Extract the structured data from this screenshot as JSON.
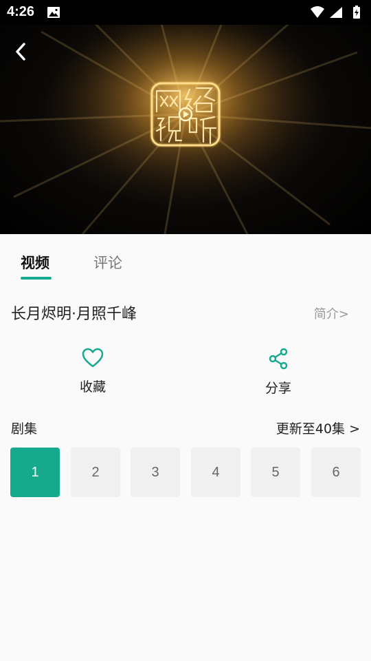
{
  "status_bar": {
    "time": "4:26"
  },
  "video": {
    "logo_text": "网络视听"
  },
  "tabs": [
    {
      "label": "视频",
      "active": true
    },
    {
      "label": "评论",
      "active": false
    }
  ],
  "title": "长月烬明·月照千峰",
  "intro_link": "简介>",
  "actions": {
    "favorite": "收藏",
    "share": "分享"
  },
  "episodes": {
    "header": "剧集",
    "update_text": "更新至40集 >",
    "items": [
      "1",
      "2",
      "3",
      "4",
      "5",
      "6"
    ],
    "active_index": 0
  },
  "colors": {
    "accent": "#17a98c"
  }
}
